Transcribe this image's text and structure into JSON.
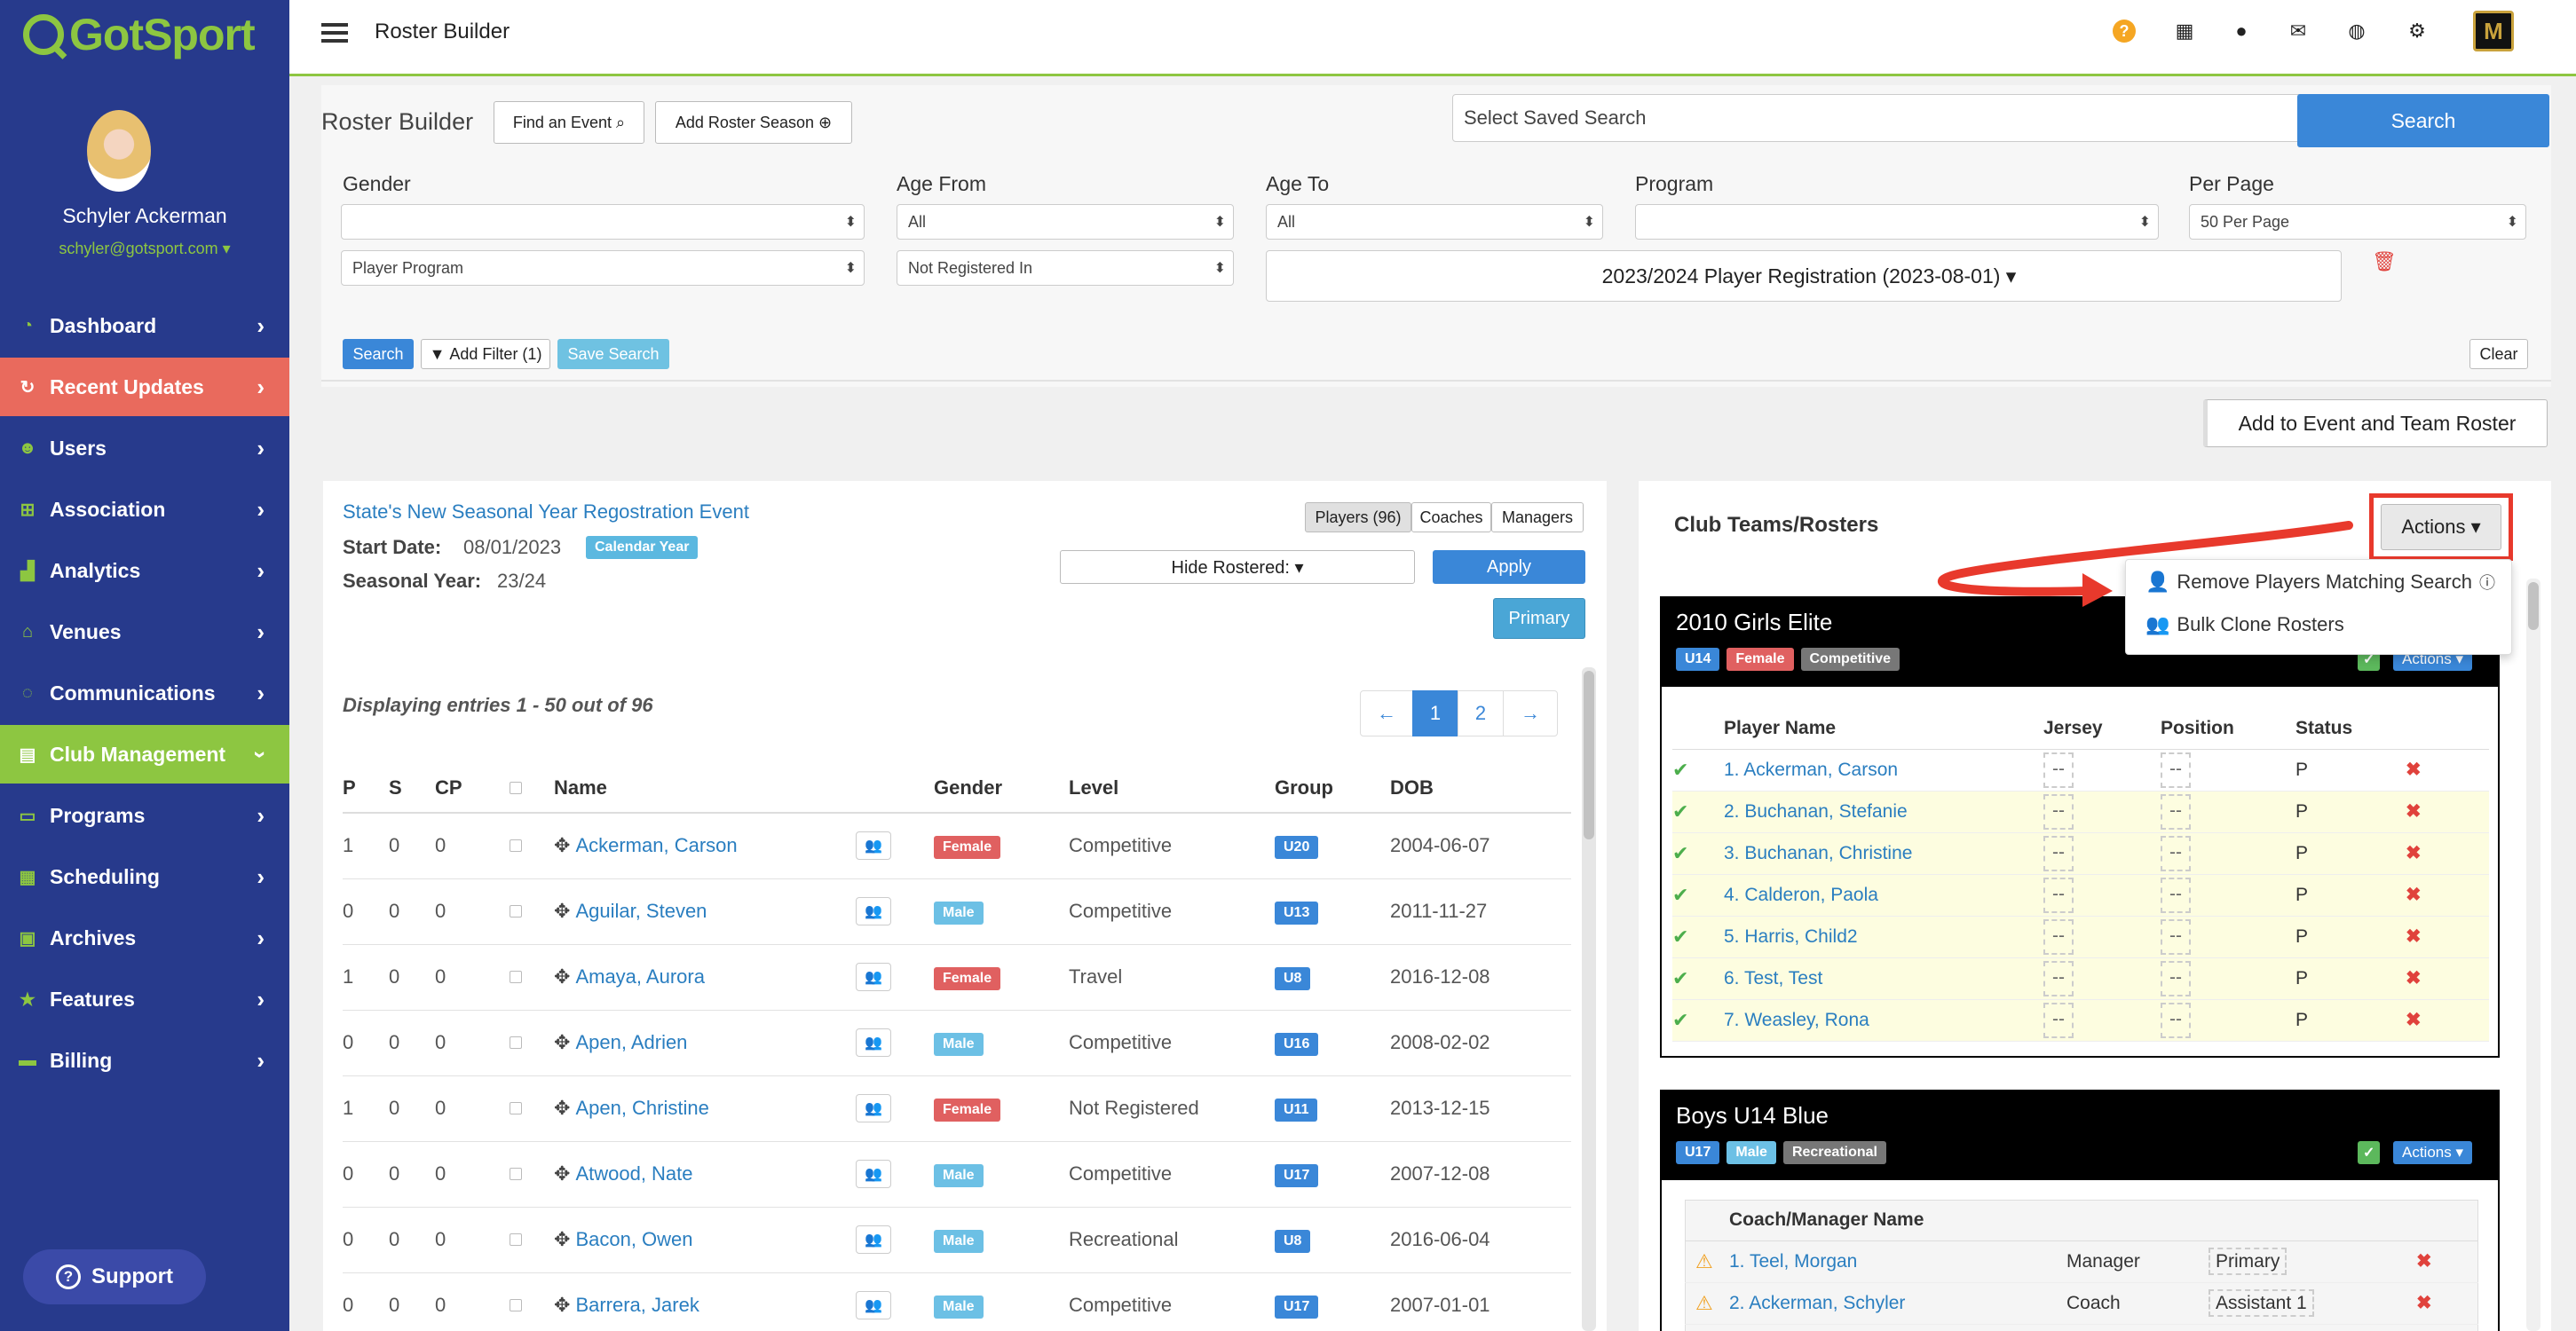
{
  "brand": {
    "name": "GotSport",
    "color": "#8dc641"
  },
  "sidebar": {
    "user_name": "Schyler Ackerman",
    "user_email": "schyler@gotsport.com ▾",
    "items": [
      {
        "label": "Dashboard",
        "icon": "dashboard-icon"
      },
      {
        "label": "Recent Updates",
        "icon": "refresh-icon"
      },
      {
        "label": "Users",
        "icon": "users-icon"
      },
      {
        "label": "Association",
        "icon": "sitemap-icon"
      },
      {
        "label": "Analytics",
        "icon": "chart-icon"
      },
      {
        "label": "Venues",
        "icon": "home-icon"
      },
      {
        "label": "Communications",
        "icon": "chat-icon"
      },
      {
        "label": "Club Management",
        "icon": "card-icon"
      },
      {
        "label": "Programs",
        "icon": "file-icon"
      },
      {
        "label": "Scheduling",
        "icon": "calendar-icon"
      },
      {
        "label": "Archives",
        "icon": "archive-icon"
      },
      {
        "label": "Features",
        "icon": "star-icon"
      },
      {
        "label": "Billing",
        "icon": "credit-card-icon"
      }
    ],
    "support_label": "Support"
  },
  "topbar": {
    "title": "Roster Builder",
    "club_logo_text": "M"
  },
  "filters": {
    "title": "Roster Builder",
    "find_event": "Find an Event",
    "add_season": "Add Roster Season",
    "saved_search_placeholder": "Select Saved Search",
    "search_button": "Search",
    "labels": {
      "gender": "Gender",
      "age_from": "Age From",
      "age_to": "Age To",
      "program": "Program",
      "per_page": "Per Page"
    },
    "values": {
      "gender": "",
      "age_from": "All",
      "age_to": "All",
      "program": "",
      "per_page": "50 Per Page",
      "player_program": "Player Program",
      "registration_status": "Not Registered In",
      "season": "2023/2024 Player Registration (2023-08-01) ▾"
    },
    "search_small": "Search",
    "add_filter": "Add Filter (1)",
    "save_search": "Save Search",
    "clear": "Clear",
    "add_to_event": "Add to Event and Team Roster"
  },
  "event": {
    "title": "State's New Seasonal Year Regostration Event",
    "start_label": "Start Date:",
    "start_value": "08/01/2023",
    "calendar_badge": "Calendar Year",
    "season_label": "Seasonal Year:",
    "season_value": "23/24",
    "tabs": [
      "Players (96)",
      "Coaches",
      "Managers"
    ],
    "hide_rostered": "Hide Rostered: ▾",
    "apply": "Apply",
    "primary": "Primary",
    "displaying": "Displaying entries 1 - 50 out of 96",
    "pages": [
      "←",
      "1",
      "2",
      "→"
    ]
  },
  "players": {
    "headers": [
      "P",
      "S",
      "CP",
      "",
      "Name",
      "",
      "Gender",
      "Level",
      "Group",
      "DOB"
    ],
    "rows": [
      {
        "p": "1",
        "s": "0",
        "cp": "0",
        "name": "Ackerman, Carson",
        "gender": "Female",
        "level": "Competitive",
        "group": "U20",
        "dob": "2004-06-07"
      },
      {
        "p": "0",
        "s": "0",
        "cp": "0",
        "name": "Aguilar, Steven",
        "gender": "Male",
        "level": "Competitive",
        "group": "U13",
        "dob": "2011-11-27"
      },
      {
        "p": "1",
        "s": "0",
        "cp": "0",
        "name": "Amaya, Aurora",
        "gender": "Female",
        "level": "Travel",
        "group": "U8",
        "dob": "2016-12-08"
      },
      {
        "p": "0",
        "s": "0",
        "cp": "0",
        "name": "Apen, Adrien",
        "gender": "Male",
        "level": "Competitive",
        "group": "U16",
        "dob": "2008-02-02"
      },
      {
        "p": "1",
        "s": "0",
        "cp": "0",
        "name": "Apen, Christine",
        "gender": "Female",
        "level": "Not Registered",
        "group": "U11",
        "dob": "2013-12-15"
      },
      {
        "p": "0",
        "s": "0",
        "cp": "0",
        "name": "Atwood, Nate",
        "gender": "Male",
        "level": "Competitive",
        "group": "U17",
        "dob": "2007-12-08"
      },
      {
        "p": "0",
        "s": "0",
        "cp": "0",
        "name": "Bacon, Owen",
        "gender": "Male",
        "level": "Recreational",
        "group": "U8",
        "dob": "2016-06-04"
      },
      {
        "p": "0",
        "s": "0",
        "cp": "0",
        "name": "Barrera, Jarek",
        "gender": "Male",
        "level": "Competitive",
        "group": "U17",
        "dob": "2007-01-01"
      }
    ]
  },
  "rosters": {
    "title": "Club Teams/Rosters",
    "actions": "Actions ▾",
    "dropdown": [
      "Remove Players Matching Search",
      "Bulk Clone Rosters"
    ],
    "team1": {
      "name": "2010 Girls Elite",
      "badges": [
        "U14",
        "Female",
        "Competitive"
      ],
      "actions": "Actions ▾",
      "headers": [
        "",
        "Player Name",
        "Jersey",
        "Position",
        "Status",
        ""
      ],
      "rows": [
        {
          "name": "1. Ackerman, Carson",
          "jersey": "--",
          "position": "--",
          "status": "P"
        },
        {
          "name": "2. Buchanan, Stefanie",
          "jersey": "--",
          "position": "--",
          "status": "P"
        },
        {
          "name": "3. Buchanan, Christine",
          "jersey": "--",
          "position": "--",
          "status": "P"
        },
        {
          "name": "4. Calderon, Paola",
          "jersey": "--",
          "position": "--",
          "status": "P"
        },
        {
          "name": "5. Harris, Child2",
          "jersey": "--",
          "position": "--",
          "status": "P"
        },
        {
          "name": "6. Test, Test",
          "jersey": "--",
          "position": "--",
          "status": "P"
        },
        {
          "name": "7. Weasley, Rona",
          "jersey": "--",
          "position": "--",
          "status": "P"
        }
      ]
    },
    "team2": {
      "name": "Boys U14 Blue",
      "badges": [
        "U17",
        "Male",
        "Recreational"
      ],
      "actions": "Actions ▾",
      "headers": [
        "",
        "Coach/Manager Name",
        "",
        ""
      ],
      "rows": [
        {
          "name": "1. Teel, Morgan",
          "role": "Manager",
          "type": "Primary"
        },
        {
          "name": "2. Ackerman, Schyler",
          "role": "Coach",
          "type": "Assistant 1"
        }
      ]
    }
  },
  "colors": {
    "sidebar": "#273a8c",
    "accent": "#8dc641",
    "highlight": "#e8392c",
    "link": "#2a7ec0"
  }
}
